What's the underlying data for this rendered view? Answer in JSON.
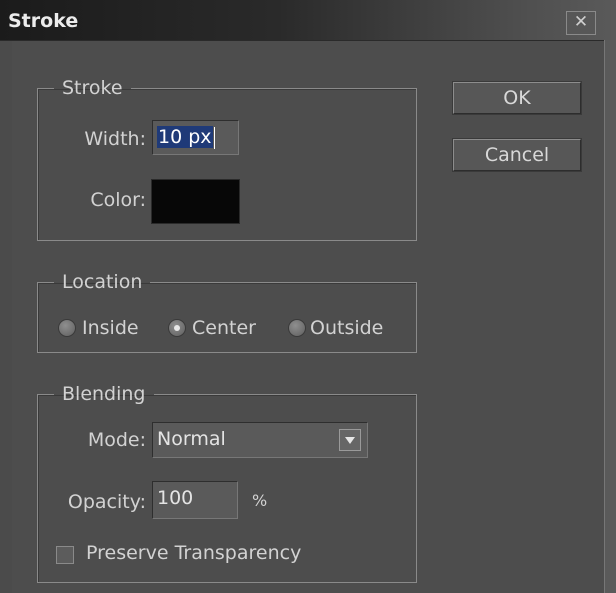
{
  "window": {
    "title": "Stroke",
    "close_symbol": "✕"
  },
  "stroke": {
    "legend": "Stroke",
    "width_label": "Width:",
    "width_value": "10 px",
    "color_label": "Color:",
    "color_value": "#070707"
  },
  "location": {
    "legend": "Location",
    "options": [
      {
        "label": "Inside",
        "selected": false
      },
      {
        "label": "Center",
        "selected": true
      },
      {
        "label": "Outside",
        "selected": false
      }
    ]
  },
  "blending": {
    "legend": "Blending",
    "mode_label": "Mode:",
    "mode_value": "Normal",
    "opacity_label": "Opacity:",
    "opacity_value": "100",
    "opacity_unit": "%",
    "preserve_label": "Preserve Transparency",
    "preserve_checked": false
  },
  "buttons": {
    "ok": "OK",
    "cancel": "Cancel"
  }
}
